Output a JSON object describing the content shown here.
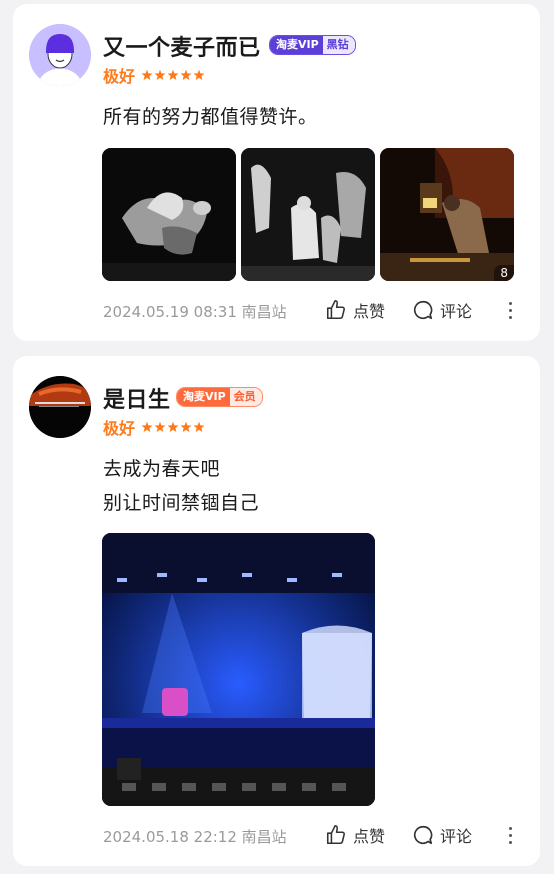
{
  "reviews": [
    {
      "username": "又一个麦子而已",
      "vip_brand": "淘麦VIP",
      "vip_level": "黑钻",
      "rating_text": "极好",
      "stars": 5,
      "text_lines": [
        "所有的努力都值得赞许。"
      ],
      "photo_count": "8",
      "meta": "2024.05.19 08:31 南昌站",
      "like_label": "点赞",
      "comment_label": "评论"
    },
    {
      "username": "是日生",
      "vip_brand": "淘麦VIP",
      "vip_level": "会员",
      "rating_text": "极好",
      "stars": 5,
      "text_lines": [
        "去成为春天吧",
        "别让时间禁锢自己"
      ],
      "meta": "2024.05.18 22:12 南昌站",
      "like_label": "点赞",
      "comment_label": "评论"
    }
  ],
  "colors": {
    "rating": "#ff7a1a",
    "vip_black_left": "#5b3fd6",
    "vip_black_right": "#ece6ff",
    "vip_member_left": "#ff6a3d",
    "vip_member_right": "#ffe9e3"
  },
  "icons": [
    "thumbs-up-icon",
    "comment-icon",
    "more-icon",
    "star-icon"
  ]
}
